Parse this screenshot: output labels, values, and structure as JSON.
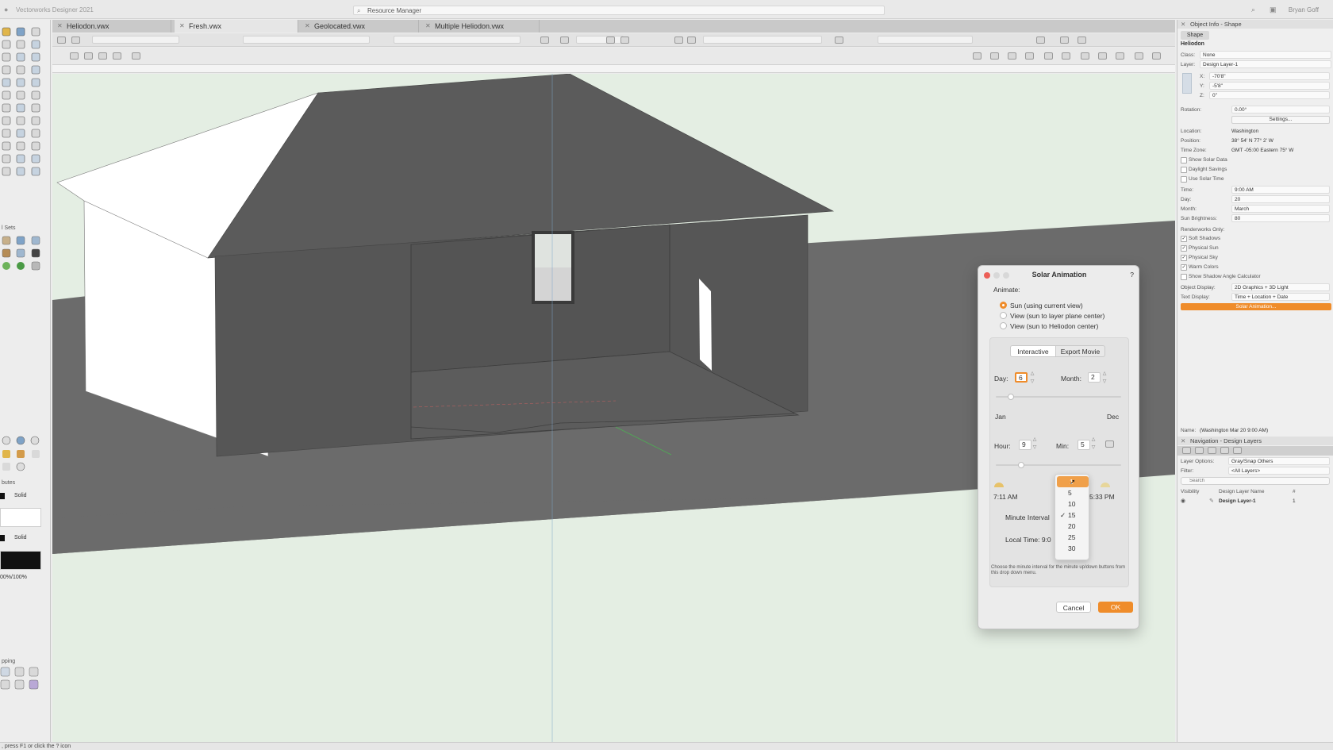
{
  "app": {
    "title": "Vectorworks Designer 2021",
    "user": "Bryan Goff"
  },
  "resource_manager": {
    "label": "Resource Manager"
  },
  "tabs": [
    {
      "label": "Heliodon.vwx",
      "active": false
    },
    {
      "label": "Fresh.vwx",
      "active": true
    },
    {
      "label": "Geolocated.vwx",
      "active": false
    },
    {
      "label": "Multiple Heliodon.vwx",
      "active": false
    }
  ],
  "left_palettes": {
    "sets_title": "l Sets",
    "attributes_title": "butes",
    "fill_style": "Solid",
    "pen_style": "Solid",
    "opacity": "00%/100%",
    "snapping_title": "pping"
  },
  "status": {
    "hint": ", press F1 or click the ? icon"
  },
  "object_info": {
    "panel_title": "Object Info - Shape",
    "tab": "Shape",
    "object_type": "Heliodon",
    "class_label": "Class:",
    "class_value": "None",
    "layer_label": "Layer:",
    "layer_value": "Design Layer-1",
    "x_label": "X:",
    "x_value": "-70'8\"",
    "y_label": "Y:",
    "y_value": "-5'8\"",
    "z_label": "Z:",
    "z_value": "0\"",
    "rotation_label": "Rotation:",
    "rotation_value": "0.00°",
    "settings_button": "Settings...",
    "location_label": "Location:",
    "location_value": "Washington",
    "position_label": "Position:",
    "position_value": "38° 54' N 77° 2' W",
    "timezone_label": "Time Zone:",
    "timezone_value": "GMT -05:00 Eastern 75° W",
    "show_solar_data": "Show Solar Data",
    "daylight_savings": "Daylight Savings",
    "use_solar_time": "Use Solar Time",
    "time_label": "Time:",
    "time_value": "9:00 AM",
    "day_label": "Day:",
    "day_value": "20",
    "month_label": "Month:",
    "month_value": "March",
    "brightness_label": "Sun Brightness:",
    "brightness_value": "80",
    "renderworks_only": "Renderworks Only:",
    "soft_shadows": "Soft Shadows",
    "physical_sun": "Physical Sun",
    "physical_sky": "Physical Sky",
    "warm_colors": "Warm Colors",
    "shadow_angle_calc": "Show Shadow Angle Calculator",
    "object_display_label": "Object Display:",
    "object_display_value": "2D Graphics + 3D Light",
    "text_display_label": "Text Display:",
    "text_display_value": "Time + Location + Date",
    "solar_animation_button": "Solar Animation...",
    "name_label": "Name:",
    "name_value": "(Washington Mar 20 9:00 AM)"
  },
  "navigation": {
    "panel_title": "Navigation - Design Layers",
    "layer_options_label": "Layer Options:",
    "layer_options_value": "Gray/Snap Others",
    "filter_label": "Filter:",
    "filter_value": "<All Layers>",
    "search_placeholder": "Search",
    "col_visibility": "Visibility",
    "col_layer_name": "Design Layer Name",
    "col_number": "#",
    "rows": [
      {
        "name": "Design Layer-1",
        "number": "1"
      }
    ]
  },
  "solar_dialog": {
    "title": "Solar Animation",
    "help": "?",
    "animate_label": "Animate:",
    "options": [
      "Sun (using current view)",
      "View (sun to layer plane center)",
      "View (sun to Heliodon center)"
    ],
    "tab_interactive": "Interactive",
    "tab_export": "Export Movie",
    "day_label": "Day:",
    "day_value": "6",
    "month_label": "Month:",
    "month_value": "2",
    "month_start": "Jan",
    "month_end": "Dec",
    "hour_label": "Hour:",
    "hour_value": "9",
    "min_label": "Min:",
    "min_value": "5",
    "sunrise": "7:11 AM",
    "sunset": "5:33 PM",
    "minute_interval_label": "Minute Interval",
    "local_time_label": "Local Time: 9:0",
    "help_text": "Choose the minute interval for the minute up/down buttons from this drop down menu.",
    "cancel": "Cancel",
    "ok": "OK"
  },
  "minute_interval_menu": {
    "options": [
      "1",
      "5",
      "10",
      "15",
      "20",
      "25",
      "30"
    ],
    "checked": "15"
  },
  "colors": {
    "accent": "#ef8c2a",
    "roof": "#5a5a5a",
    "wall": "#555555",
    "ground": "#6a6a6a",
    "viewport_bg": "#e4eee3"
  }
}
